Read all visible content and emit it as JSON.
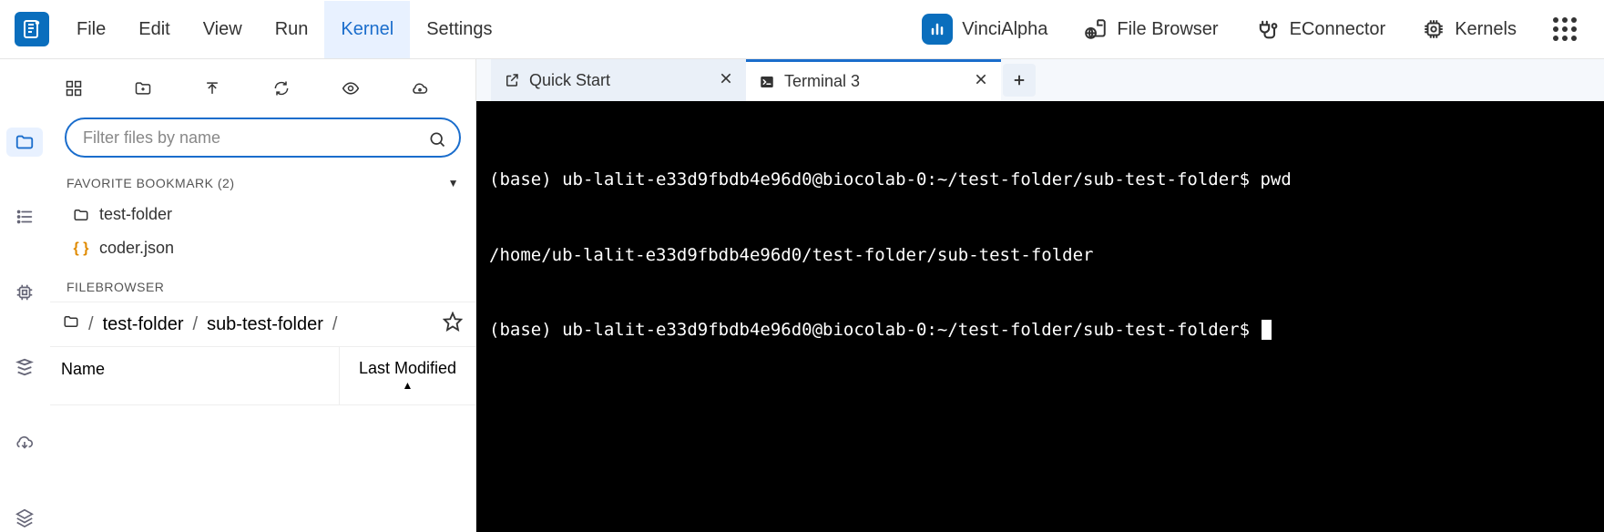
{
  "menu": {
    "file": "File",
    "edit": "Edit",
    "view": "View",
    "run": "Run",
    "kernel": "Kernel",
    "settings": "Settings"
  },
  "top_right": {
    "vinci": "VinciAlpha",
    "filebrowser": "File Browser",
    "econnector": "EConnector",
    "kernels": "Kernels"
  },
  "sidebar": {
    "filter_placeholder": "Filter files by name",
    "favorite_header": "FAVORITE BOOKMARK (2)",
    "favorites": [
      {
        "label": "test-folder",
        "type": "folder"
      },
      {
        "label": "coder.json",
        "type": "json"
      }
    ],
    "filebrowser_header": "FILEBROWSER",
    "breadcrumb": {
      "segs": [
        "test-folder",
        "sub-test-folder"
      ]
    },
    "columns": {
      "name": "Name",
      "modified": "Last Modified"
    }
  },
  "tabs": {
    "quickstart": "Quick Start",
    "terminal": "Terminal 3"
  },
  "terminal": {
    "line1": "(base) ub-lalit-e33d9fbdb4e96d0@biocolab-0:~/test-folder/sub-test-folder$ pwd",
    "line2": "/home/ub-lalit-e33d9fbdb4e96d0/test-folder/sub-test-folder",
    "line3": "(base) ub-lalit-e33d9fbdb4e96d0@biocolab-0:~/test-folder/sub-test-folder$ "
  }
}
